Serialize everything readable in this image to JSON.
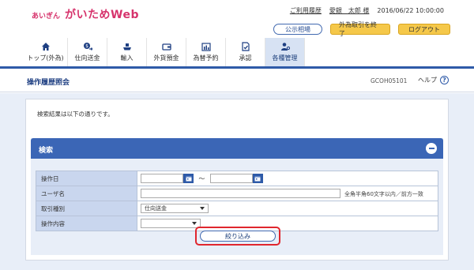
{
  "header": {
    "logo_small": "あいぎん",
    "logo_big": "がいためWeb",
    "usage_history": "ご利用履歴",
    "user_name": "愛銀　太郎 様",
    "datetime": "2016/06/22 10:00:00",
    "btn_public_rate": "公示相場",
    "btn_exit_fx": "外為取引を終了",
    "btn_logout": "ログアウト"
  },
  "nav": {
    "items": [
      {
        "label": "トップ(外為)",
        "icon": "home-icon"
      },
      {
        "label": "仕向送金",
        "icon": "coin-transfer-icon"
      },
      {
        "label": "輸入",
        "icon": "ship-icon"
      },
      {
        "label": "外貨預金",
        "icon": "wallet-icon"
      },
      {
        "label": "為替予約",
        "icon": "calendar-chart-icon"
      },
      {
        "label": "承認",
        "icon": "approval-icon"
      },
      {
        "label": "各種管理",
        "icon": "user-settings-icon"
      }
    ],
    "active_index": 6
  },
  "page": {
    "title": "操作履歴照会",
    "screen_id": "GCOH05101",
    "help": "ヘルプ",
    "help_symbol": "?"
  },
  "result": {
    "message": "検索結果は以下の通りです。"
  },
  "search": {
    "title": "検索",
    "fields": {
      "operation_date_label": "操作日",
      "tilde": "～",
      "user_name_label": "ユーザ名",
      "user_name_hint": "全角半角60文字以内／前方一致",
      "transaction_type_label": "取引種別",
      "transaction_type_value": "仕向送金",
      "operation_content_label": "操作内容",
      "operation_content_value": ""
    },
    "filter_button": "絞り込み"
  },
  "colors": {
    "brand_pink": "#d6336c",
    "nav_blue": "#2e5aa8",
    "search_header": "#3b66b6",
    "highlight_red": "#e0262e",
    "button_yellow": "#f5c84a"
  }
}
